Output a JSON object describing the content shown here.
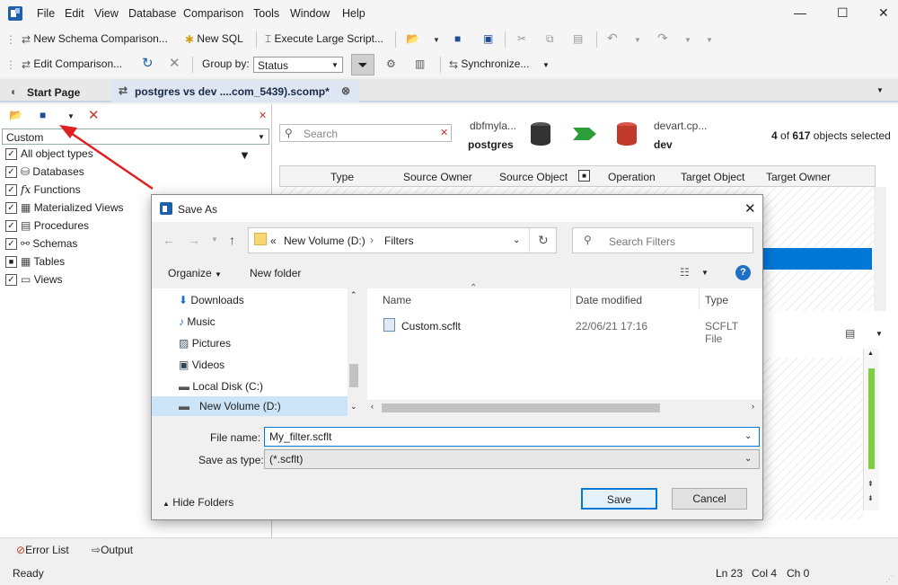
{
  "menu": [
    "File",
    "Edit",
    "View",
    "Database",
    "Comparison",
    "Tools",
    "Window",
    "Help"
  ],
  "toolbar1": {
    "new_schema_comparison": "New Schema Comparison...",
    "new_sql": "New SQL",
    "execute_large_script": "Execute Large Script..."
  },
  "toolbar2": {
    "edit_comparison": "Edit Comparison...",
    "group_by_label": "Group by:",
    "group_by_value": "Status",
    "synchronize": "Synchronize..."
  },
  "tabs": {
    "start_page": "Start Page",
    "comparison": "postgres vs dev ....com_5439).scomp*"
  },
  "left_panel": {
    "filter_combo": "Custom",
    "items": [
      {
        "label": "All object types",
        "checked": true
      },
      {
        "label": "Databases",
        "checked": true
      },
      {
        "label": "Functions",
        "checked": true
      },
      {
        "label": "Materialized Views",
        "checked": true
      },
      {
        "label": "Procedures",
        "checked": true
      },
      {
        "label": "Schemas",
        "checked": true
      },
      {
        "label": "Tables",
        "checked": false
      },
      {
        "label": "Views",
        "checked": true
      }
    ]
  },
  "compare": {
    "search_placeholder": "Search",
    "source_server": "dbfmyla...",
    "source_db": "postgres",
    "target_server": "devart.cp...",
    "target_db": "dev",
    "selected_count": "4",
    "of_text": "of",
    "total_count": "617",
    "selected_suffix": "objects selected",
    "columns": [
      "Type",
      "Source Owner",
      "Source Object",
      "Operation",
      "Target Object",
      "Target Owner"
    ]
  },
  "dialog": {
    "title": "Save As",
    "address": {
      "prefix": "«",
      "volume": "New Volume (D:)",
      "folder": "Filters"
    },
    "search_placeholder": "Search Filters",
    "organize": "Organize",
    "new_folder": "New folder",
    "nav_items": [
      "Downloads",
      "Music",
      "Pictures",
      "Videos",
      "Local Disk (C:)",
      "New Volume (D:)"
    ],
    "file_columns": {
      "name": "Name",
      "date": "Date modified",
      "type": "Type"
    },
    "files": [
      {
        "name": "Custom.scflt",
        "date": "22/06/21 17:16",
        "type": "SCFLT File"
      }
    ],
    "file_name_label": "File name:",
    "file_name_value": "My_filter.scflt",
    "save_type_label": "Save as type:",
    "save_type_value": "(*.scflt)",
    "hide_folders": "Hide Folders",
    "save": "Save",
    "cancel": "Cancel"
  },
  "bottom_tabs": {
    "error_list": "Error List",
    "output": "Output"
  },
  "status": {
    "ready": "Ready",
    "ln": "Ln 23",
    "col": "Col 4",
    "ch": "Ch 0"
  },
  "colors": {
    "accent": "#0078d7",
    "source_db": "#333333",
    "target_db": "#c0392b",
    "arrow": "#2e9e3a",
    "annotation": "#e02020"
  }
}
